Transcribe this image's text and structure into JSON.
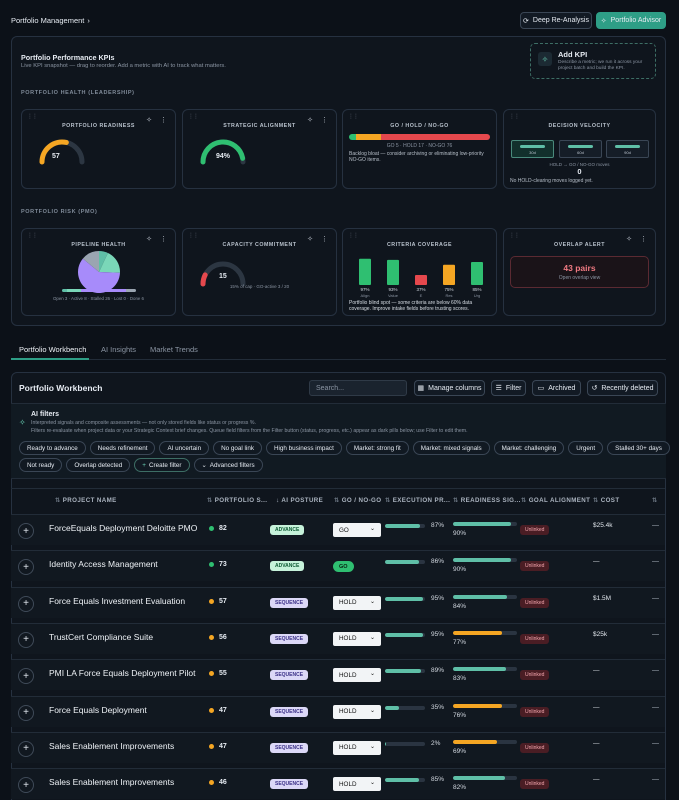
{
  "header": {
    "breadcrumb": "Portfolio Management",
    "breadcrumb_chevron": "›",
    "deep_reanalysis": "Deep Re-Analysis",
    "portfolio_advisor": "Portfolio Advisor"
  },
  "kpi_panel": {
    "title": "Portfolio Performance KPIs",
    "subtitle": "Live KPI snapshot — drag to reorder. Add a metric with AI to track what matters.",
    "add_kpi_title": "Add KPI",
    "add_kpi_desc": "Describe a metric; we run it across your project batch and build the KPI.",
    "section_health": "PORTFOLIO HEALTH (LEADERSHIP)",
    "section_risk": "PORTFOLIO RISK (PMO)"
  },
  "kpis": {
    "readiness": {
      "title": "PORTFOLIO READINESS",
      "value": "57",
      "fraction": 0.57
    },
    "alignment": {
      "title": "STRATEGIC ALIGNMENT",
      "value": "94%",
      "fraction": 0.94
    },
    "gonogo": {
      "title": "GO / HOLD / NO-GO",
      "summary": "GO 5 · HOLD 17 · NO-GO 76",
      "note": "Backlog bloat — consider archiving or eliminating low-priority NO-GO items.",
      "go": 5,
      "hold": 17,
      "nogo": 76
    },
    "velocity": {
      "title": "DECISION VELOCITY",
      "stage1": "30d",
      "stage2": "60d",
      "stage3": "90d",
      "caption": "HOLD → GO / NO-GO moves",
      "value": "0",
      "note": "No HOLD-clearing moves logged yet."
    },
    "pipeline": {
      "title": "PIPELINE HEALTH",
      "legend": "Open 3 · Active 8 · Stalled 26 · Lost 0 · Done 6",
      "open": 3,
      "active": 8,
      "stalled": 26,
      "lost": 0,
      "done": 6
    },
    "capacity": {
      "title": "CAPACITY COMMITMENT",
      "value": "15",
      "note": "15% of cap · GO-active 3 / 20",
      "fraction": 0.15
    },
    "coverage": {
      "title": "CRITERIA COVERAGE",
      "bars": [
        {
          "pct": "97%",
          "label": "Align",
          "value": 97,
          "color": "#2fbf71"
        },
        {
          "pct": "93%",
          "label": "Value",
          "value": 93,
          "color": "#2fbf71"
        },
        {
          "pct": "37%",
          "label": "E",
          "value": 37,
          "color": "#e5484d"
        },
        {
          "pct": "75%",
          "label": "Res",
          "value": 75,
          "color": "#f5a623"
        },
        {
          "pct": "85%",
          "label": "Urg",
          "value": 85,
          "color": "#2fbf71"
        }
      ],
      "note": "Portfolio blind spot — some criteria are below 60% data coverage. Improve intake fields before trusting scores."
    },
    "overlap": {
      "title": "OVERLAP ALERT",
      "value": "43 pairs",
      "link": "Open overlap view"
    }
  },
  "tabs": [
    "Portfolio Workbench",
    "AI Insights",
    "Market Trends"
  ],
  "workbench": {
    "title": "Portfolio Workbench",
    "search_placeholder": "Search...",
    "manage_columns": "Manage columns",
    "filter": "Filter",
    "archived": "Archived",
    "recently_deleted": "Recently deleted",
    "ai_filters_title": "AI filters",
    "ai_filters_line1": "Interpreted signals and composite assessments — not only stored fields like status or progress %.",
    "ai_filters_line2": "Filters re-evaluate when project data or your Strategic Context brief changes. Queue field filters from the Filter button (status, progress, etc.) appear as dark pills below; use Filter to edit them.",
    "chips_row1": [
      "Ready to advance",
      "Needs refinement",
      "AI uncertain",
      "No goal link",
      "High business impact",
      "Market: strong fit",
      "Market: mixed signals",
      "Market: challenging",
      "Urgent",
      "Stalled 30+ days"
    ],
    "chips_row2": [
      "Not ready",
      "Overlap detected"
    ],
    "create_filter": "Create filter",
    "advanced_filters": "Advanced filters",
    "columns": [
      "PROJECT NAME",
      "PORTFOLIO S...",
      "AI POSTURE",
      "GO / NO-GO",
      "EXECUTION PR...",
      "READINESS SIG...",
      "GOAL ALIGNMENT",
      "COST"
    ],
    "rows": [
      {
        "name": "ForceEquals Deployment Deloitte PMO",
        "score": "82",
        "score_color": "#2fbf71",
        "posture": "ADVANCE",
        "gonogo": "GO",
        "gonogo_kind": "select",
        "exec": "87%",
        "exec_v": 0.87,
        "ready": "90%",
        "ready_v": 0.9,
        "ready_color": "#5fbfa7",
        "goal": "Unlinked",
        "cost": "$25.4k",
        "extra": "—"
      },
      {
        "name": "Identity Access Management",
        "score": "73",
        "score_color": "#2fbf71",
        "posture": "ADVANCE",
        "gonogo": "GO",
        "gonogo_kind": "pill",
        "exec": "86%",
        "exec_v": 0.86,
        "ready": "90%",
        "ready_v": 0.9,
        "ready_color": "#5fbfa7",
        "goal": "Unlinked",
        "cost": "—",
        "extra": "—"
      },
      {
        "name": "Force Equals Investment Evaluation",
        "score": "57",
        "score_color": "#f5a623",
        "posture": "SEQUENCE",
        "gonogo": "HOLD",
        "gonogo_kind": "select",
        "exec": "95%",
        "exec_v": 0.95,
        "ready": "84%",
        "ready_v": 0.84,
        "ready_color": "#5fbfa7",
        "goal": "Unlinked",
        "cost": "$1.5M",
        "extra": "—"
      },
      {
        "name": "TrustCert Compliance Suite",
        "score": "56",
        "score_color": "#f5a623",
        "posture": "SEQUENCE",
        "gonogo": "HOLD",
        "gonogo_kind": "select",
        "exec": "95%",
        "exec_v": 0.95,
        "ready": "77%",
        "ready_v": 0.77,
        "ready_color": "#f5a623",
        "goal": "Unlinked",
        "cost": "$25k",
        "extra": "—"
      },
      {
        "name": "PMI LA Force Equals Deployment Pilot",
        "score": "55",
        "score_color": "#f5a623",
        "posture": "SEQUENCE",
        "gonogo": "HOLD",
        "gonogo_kind": "select",
        "exec": "89%",
        "exec_v": 0.89,
        "ready": "83%",
        "ready_v": 0.83,
        "ready_color": "#5fbfa7",
        "goal": "Unlinked",
        "cost": "—",
        "extra": "—"
      },
      {
        "name": "Force Equals Deployment",
        "score": "47",
        "score_color": "#f5a623",
        "posture": "SEQUENCE",
        "gonogo": "HOLD",
        "gonogo_kind": "select",
        "exec": "35%",
        "exec_v": 0.35,
        "ready": "76%",
        "ready_v": 0.76,
        "ready_color": "#f5a623",
        "goal": "Unlinked",
        "cost": "—",
        "extra": "—"
      },
      {
        "name": "Sales Enablement Improvements",
        "score": "47",
        "score_color": "#f5a623",
        "posture": "SEQUENCE",
        "gonogo": "HOLD",
        "gonogo_kind": "select",
        "exec": "2%",
        "exec_v": 0.02,
        "ready": "69%",
        "ready_v": 0.69,
        "ready_color": "#f5a623",
        "goal": "Unlinked",
        "cost": "—",
        "extra": "—"
      },
      {
        "name": "Sales Enablement Improvements",
        "score": "46",
        "score_color": "#f5a623",
        "posture": "SEQUENCE",
        "gonogo": "HOLD",
        "gonogo_kind": "select",
        "exec": "85%",
        "exec_v": 0.85,
        "ready": "82%",
        "ready_v": 0.82,
        "ready_color": "#5fbfa7",
        "goal": "Unlinked",
        "cost": "—",
        "extra": "—"
      }
    ]
  },
  "colors": {
    "accent": "#2e9e86",
    "go": "#2fbf71",
    "hold": "#f5a623",
    "nogo": "#e5484d"
  }
}
